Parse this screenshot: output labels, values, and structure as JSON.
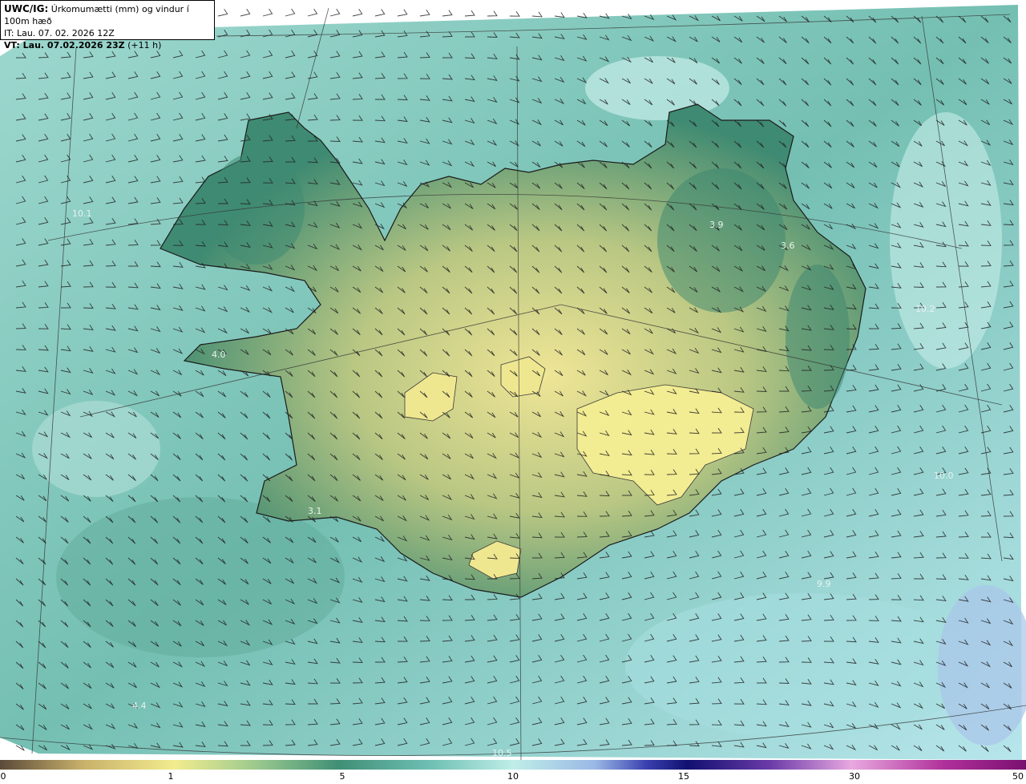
{
  "title": {
    "model_prefix": "UWC/IG:",
    "product": "Úrkomumætti (mm) og vindur í 100m hæð",
    "init_time": "IT: Lau. 07. 02. 2026 12Z",
    "valid_prefix": "VT: Lau. 07.02.2026 23Z",
    "valid_lead": "(+11 h)"
  },
  "colorbar": {
    "ticks": [
      "0",
      "1",
      "5",
      "10",
      "15",
      "30",
      "50"
    ],
    "colors": [
      "#5a4a3a",
      "#c8b06a",
      "#f2ec8e",
      "#9bc98e",
      "#3f8f76",
      "#2f7d6b",
      "#6fc0b4",
      "#bfeee8",
      "#9ab8e6",
      "#3a40b0",
      "#101070",
      "#6a3aa8",
      "#e8a8e0",
      "#b0309a",
      "#7a1070"
    ]
  },
  "map_labels": [
    {
      "name": "value-label",
      "text": "10.1"
    },
    {
      "name": "value-label",
      "text": "4.0"
    },
    {
      "name": "value-label",
      "text": "3.1"
    },
    {
      "name": "value-label",
      "text": "4.4"
    },
    {
      "name": "value-label",
      "text": "3.9"
    },
    {
      "name": "value-label",
      "text": "3.6"
    },
    {
      "name": "value-label",
      "text": "10.2"
    },
    {
      "name": "value-label",
      "text": "10.0"
    },
    {
      "name": "value-label",
      "text": "9.9"
    },
    {
      "name": "value-label",
      "text": "10.5"
    }
  ]
}
